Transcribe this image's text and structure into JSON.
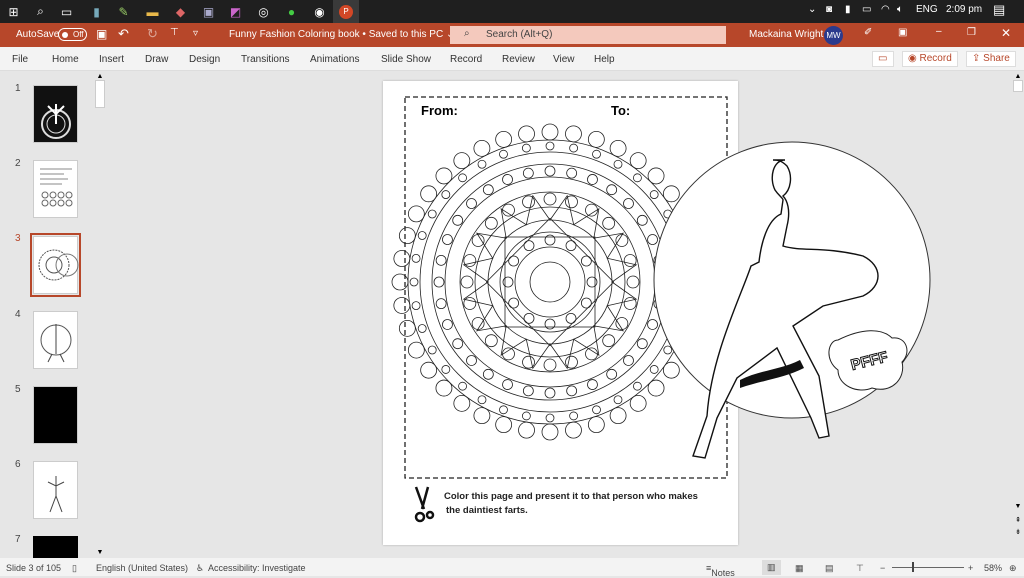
{
  "taskbar": {
    "icons": [
      "windows-icon",
      "search-icon",
      "task-view-icon",
      "notes-icon",
      "paint-icon",
      "file-explorer-icon",
      "app-icon",
      "remote-desktop-icon",
      "paint3d-icon",
      "obs-icon",
      "chrome-icon",
      "media-icon",
      "powerpoint-icon"
    ],
    "language": "ENG",
    "time": "2:09 pm"
  },
  "titlebar": {
    "autosave": "AutoSave",
    "autosave_state": "Off",
    "doc_title": "Funny Fashion Coloring book • Saved to this PC ⌄",
    "search_placeholder": "Search (Alt+Q)",
    "user_name": "Mackaina Wright",
    "user_initials": "MW",
    "accent": "#b7472a"
  },
  "menu": [
    "File",
    "Home",
    "Insert",
    "Draw",
    "Design",
    "Transitions",
    "Animations",
    "Slide Show",
    "Record",
    "Review",
    "View",
    "Help"
  ],
  "ribbon_buttons": {
    "record": "Record",
    "share": "Share"
  },
  "thumbnails": [
    {
      "n": "1"
    },
    {
      "n": "2"
    },
    {
      "n": "3",
      "selected": true
    },
    {
      "n": "4"
    },
    {
      "n": "5"
    },
    {
      "n": "6"
    },
    {
      "n": "7"
    }
  ],
  "slide": {
    "from": "From:",
    "to": "To:",
    "caption_line1": "Color this page and present it to that person who makes",
    "caption_line2": "the daintiest farts.",
    "bubble_text": "PFFF"
  },
  "status": {
    "slide": "Slide 3 of 105",
    "language": "English (United States)",
    "accessibility": "Accessibility: Investigate",
    "notes": "Notes",
    "zoom": "58%",
    "zoom_percent": 58
  }
}
